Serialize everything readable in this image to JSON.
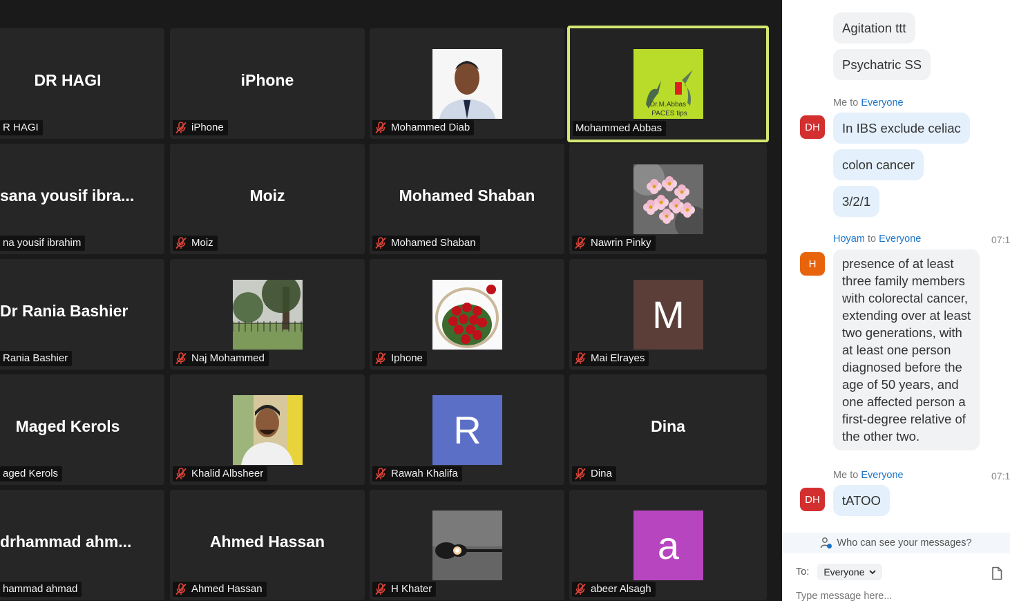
{
  "gallery": {
    "tiles": [
      {
        "display": "DR HAGI",
        "name": "R HAGI",
        "muted": false
      },
      {
        "display": "iPhone",
        "name": "iPhone",
        "muted": true
      },
      {
        "display": "",
        "name": "Mohammed Diab",
        "muted": true,
        "picture": "portrait-photo"
      },
      {
        "display": "",
        "name": "Mohammed Abbas",
        "muted": false,
        "active": true,
        "picture": "hummingbird-logo",
        "picture_text": "Dr.M.Abbas PACES tips"
      },
      {
        "display": "sana  yousif  ibra...",
        "name": "na yousif ibrahim",
        "muted": false
      },
      {
        "display": "Moiz",
        "name": "Moiz",
        "muted": true
      },
      {
        "display": "Mohamed Shaban",
        "name": "Mohamed Shaban",
        "muted": true
      },
      {
        "display": "",
        "name": "Nawrin Pinky",
        "muted": true,
        "picture": "flowers-photo"
      },
      {
        "display": "Dr Rania Bashier",
        "name": "Rania Bashier",
        "muted": false
      },
      {
        "display": "",
        "name": "Naj Mohammed",
        "muted": true,
        "picture": "park-photo"
      },
      {
        "display": "",
        "name": "Iphone",
        "muted": true,
        "picture": "roses-photo"
      },
      {
        "display": "",
        "name": "Mai Elrayes",
        "muted": true,
        "picture": "letter-avatar",
        "letter": "M",
        "color": "#5a3e37"
      },
      {
        "display": "Maged Kerols",
        "name": "aged Kerols",
        "muted": false
      },
      {
        "display": "",
        "name": "Khalid Albsheer",
        "muted": true,
        "picture": "person-photo"
      },
      {
        "display": "",
        "name": "Rawah Khalifa",
        "muted": true,
        "picture": "letter-avatar",
        "letter": "R",
        "color": "#5b6fc7"
      },
      {
        "display": "Dina",
        "name": "Dina",
        "muted": true
      },
      {
        "display": "drhammad  ahm...",
        "name": "hammad ahmad",
        "muted": false
      },
      {
        "display": "Ahmed Hassan",
        "name": "Ahmed Hassan",
        "muted": true
      },
      {
        "display": "",
        "name": "H Khater",
        "muted": true,
        "picture": "guitar-photo"
      },
      {
        "display": "",
        "name": "abeer Alsagh",
        "muted": true,
        "picture": "letter-avatar",
        "letter": "a",
        "color": "#b845c0"
      }
    ]
  },
  "chat": {
    "messages": [
      {
        "text": "Agitation ttt"
      },
      {
        "text": "Psychatric SS"
      },
      {
        "sender": "Me",
        "to_word": "to",
        "recipient": "Everyone",
        "avatar": "DH"
      },
      {
        "text": "In IBS exclude celiac"
      },
      {
        "text": "colon cancer"
      },
      {
        "text": "3/2/1"
      },
      {
        "sender": "Hoyam",
        "to_word": "to",
        "recipient": "Everyone",
        "time": "07:1",
        "avatar": "H"
      },
      {
        "text_lines": [
          "presence of at least",
          "three family members",
          "with colorectal cancer,",
          "extending over at least",
          "two generations, with",
          "at least one person",
          "diagnosed before the",
          "age of 50 years, and",
          "one affected person a",
          "first-degree relative of",
          "the other two."
        ]
      },
      {
        "sender": "Me",
        "to_word": "to",
        "recipient": "Everyone",
        "time": "07:1",
        "avatar": "DH"
      },
      {
        "text": "tATOO"
      }
    ],
    "who_can_see": "Who can see your messages?",
    "to_label": "To:",
    "to_value": "Everyone",
    "input_placeholder": "Type message here..."
  }
}
